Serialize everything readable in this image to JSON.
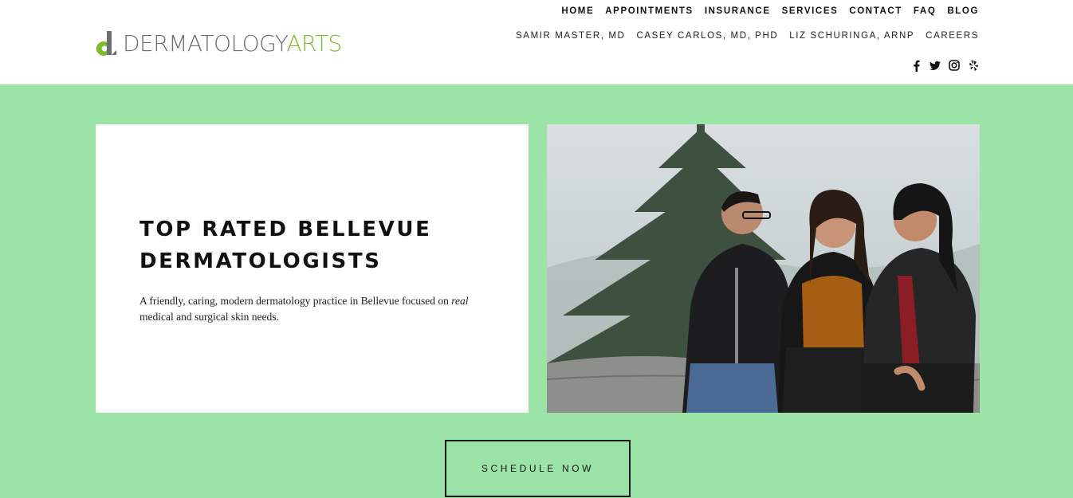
{
  "brand": {
    "name_dark": "DERMATOLOGY",
    "name_green": "ARTS",
    "colors": {
      "gray": "#6d6e70",
      "green": "#7dbb2d",
      "hero_bg": "#9ce3a7"
    }
  },
  "nav": {
    "primary": [
      "HOME",
      "APPOINTMENTS",
      "INSURANCE",
      "SERVICES",
      "CONTACT",
      "FAQ",
      "BLOG"
    ],
    "secondary": [
      "SAMIR MASTER, MD",
      "CASEY CARLOS, MD, PHD",
      "LIZ SCHURINGA, ARNP",
      "CAREERS"
    ]
  },
  "social": [
    "facebook-icon",
    "twitter-icon",
    "instagram-icon",
    "yelp-icon"
  ],
  "hero": {
    "title_line1": "TOP RATED BELLEVUE",
    "title_line2": "DERMATOLOGISTS",
    "desc_before": "A friendly, caring, modern dermatology practice in Bellevue focused on ",
    "desc_em": "real",
    "desc_after": " medical and surgical skin needs.",
    "cta_label": "SCHEDULE NOW"
  }
}
